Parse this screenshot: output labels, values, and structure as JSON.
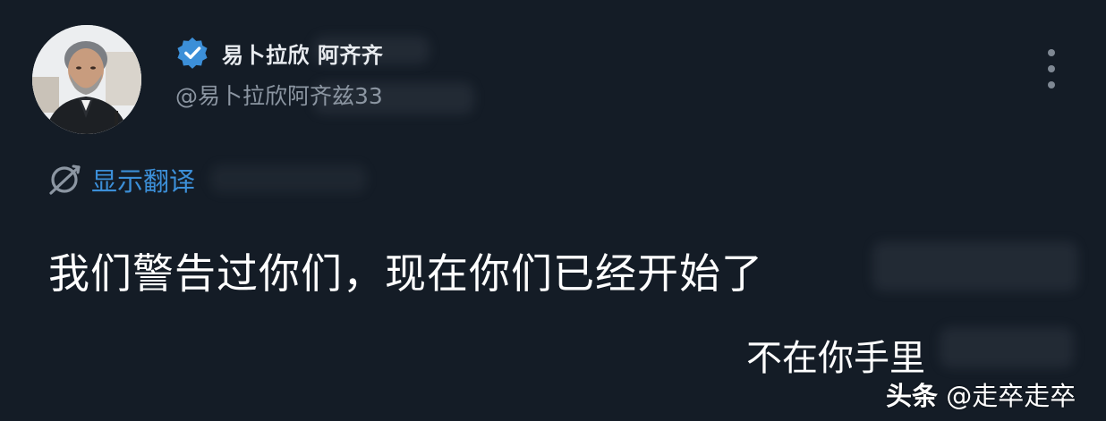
{
  "post": {
    "author": {
      "display_name": "易卜拉欣 阿齐齐",
      "handle": "@易卜拉欣阿齐兹33",
      "verified": true,
      "avatar_icon": "person-portrait"
    },
    "translate_label": "显示翻译",
    "body_text": "我们警告过你们，现在你们已经开始了",
    "overlay_text": "不在你手里",
    "more_icon": "vertical-ellipsis-icon"
  },
  "watermark": {
    "brand": "头条",
    "account": "@走卒走卒"
  },
  "colors": {
    "background": "#141c26",
    "verified_badge": "#3c8fd8",
    "translate_link": "#3c8fd8",
    "handle_text": "#8c96a2",
    "body_text": "#ffffff"
  }
}
